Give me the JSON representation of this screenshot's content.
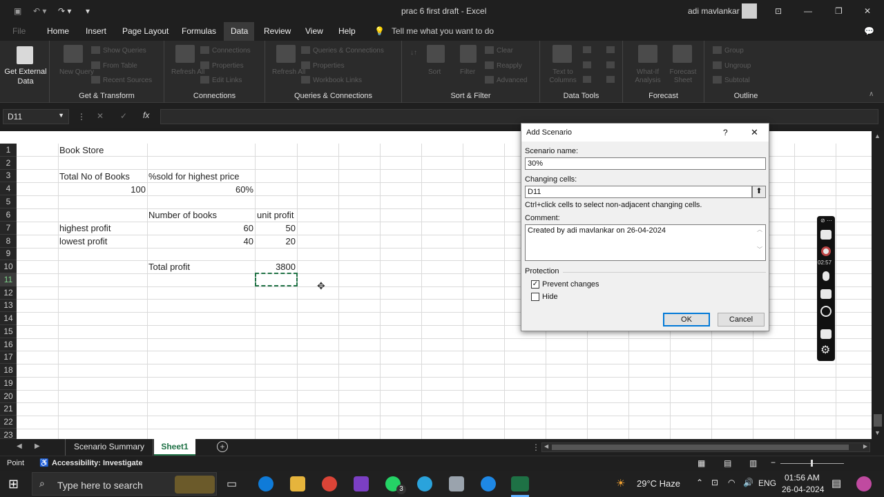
{
  "window": {
    "title": "prac 6 first draft  -  Excel",
    "user": "adi mavlankar"
  },
  "tabs": [
    "File",
    "Home",
    "Insert",
    "Page Layout",
    "Formulas",
    "Data",
    "Review",
    "View",
    "Help"
  ],
  "tell_me": "Tell me what you want to do",
  "ribbon": {
    "get_external_data": "Get External Data",
    "new_query": "New Query",
    "show_queries": "Show Queries",
    "from_table": "From Table",
    "recent_sources": "Recent Sources",
    "refresh_all": "Refresh All",
    "connections": "Connections",
    "properties": "Properties",
    "edit_links": "Edit Links",
    "queries_connections": "Queries & Connections",
    "workbook_links": "Workbook Links",
    "sort": "Sort",
    "filter": "Filter",
    "clear": "Clear",
    "reapply": "Reapply",
    "advanced": "Advanced",
    "text_to_columns": "Text to Columns",
    "what_if": "What-If Analysis",
    "forecast_sheet": "Forecast Sheet",
    "group": "Group",
    "ungroup": "Ungroup",
    "subtotal": "Subtotal",
    "groups": [
      "Get & Transform",
      "Connections",
      "Queries & Connections",
      "Sort & Filter",
      "Data Tools",
      "Forecast",
      "Outline"
    ]
  },
  "name_box": "D11",
  "columns": [
    "A",
    "B",
    "C",
    "D",
    "E",
    "F",
    "G",
    "H",
    "I",
    "J",
    "K",
    "L",
    "M",
    "N",
    "O",
    "P",
    "Q",
    "R"
  ],
  "rows": [
    "1",
    "2",
    "3",
    "4",
    "5",
    "6",
    "7",
    "8",
    "9",
    "10",
    "11",
    "12",
    "13",
    "14",
    "15",
    "16",
    "17",
    "18",
    "19",
    "20",
    "21",
    "22",
    "23"
  ],
  "cells": {
    "B1": "Book Store",
    "B3": "Total No of Books",
    "C3": "%sold for highest price",
    "B4": "100",
    "C4": "60%",
    "C6": "Number of books",
    "D6": "unit profit",
    "B7": "highest profit",
    "C7": "60",
    "D7": "50",
    "B8": "lowest profit",
    "C8": "40",
    "D8": "20",
    "C10": "Total profit",
    "D10": "3800"
  },
  "dialog": {
    "title": "Add Scenario",
    "help": "?",
    "close": "✕",
    "scenario_name_label": "Scenario name:",
    "scenario_name": "30%",
    "changing_cells_label": "Changing cells:",
    "changing_cells": "D11",
    "hint": "Ctrl+click cells to select non-adjacent changing cells.",
    "comment_label": "Comment:",
    "comment": "Created by adi mavlankar on 26-04-2024",
    "protection_label": "Protection",
    "prevent_changes": "Prevent changes",
    "prevent_checked": true,
    "hide": "Hide",
    "hide_checked": false,
    "ok": "OK",
    "cancel": "Cancel"
  },
  "sheets": {
    "tab1": "Scenario Summary",
    "tab2": "Sheet1",
    "active": "Sheet1"
  },
  "status": {
    "mode": "Point",
    "accessibility": "Accessibility: Investigate"
  },
  "recorder": {
    "time": "02:57"
  },
  "taskbar": {
    "search_placeholder": "Type here to search",
    "weather": "29°C  Haze",
    "lang": "ENG",
    "time": "01:56 AM",
    "date": "26-04-2024",
    "whatsapp_badge": "3"
  }
}
